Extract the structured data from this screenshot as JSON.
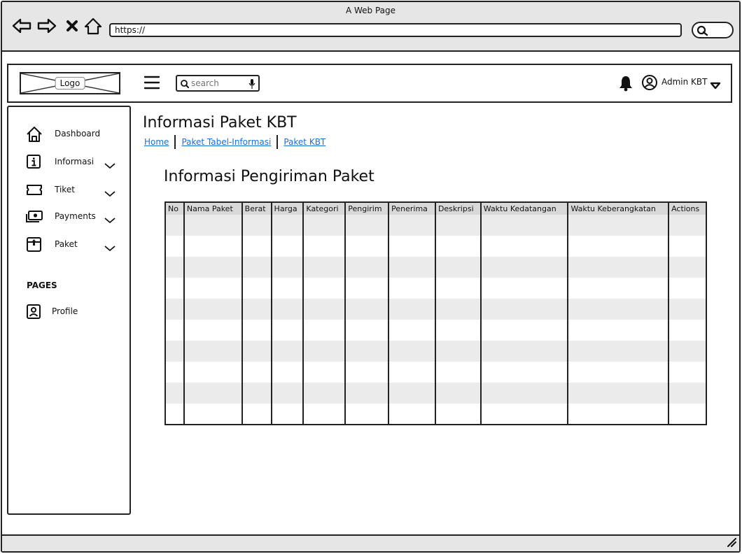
{
  "browser": {
    "title": "A Web Page",
    "url": "https://"
  },
  "topnav": {
    "logo_label": "Logo",
    "search_placeholder": "search",
    "user_name": "Admin KBT"
  },
  "sidebar": {
    "items": [
      {
        "label": "Dashboard",
        "icon": "home-icon",
        "has_dropdown": false
      },
      {
        "label": "Informasi",
        "icon": "info-icon",
        "has_dropdown": true
      },
      {
        "label": "Tiket",
        "icon": "ticket-icon",
        "has_dropdown": true
      },
      {
        "label": "Payments",
        "icon": "payments-icon",
        "has_dropdown": true
      },
      {
        "label": "Paket",
        "icon": "package-icon",
        "has_dropdown": true
      }
    ],
    "pages_heading": "PAGES",
    "pages": [
      {
        "label": "Profile",
        "icon": "profile-icon"
      }
    ]
  },
  "main": {
    "title": "Informasi Paket KBT",
    "breadcrumb": [
      "Home",
      "Paket Tabel-Informasi",
      "Paket KBT"
    ],
    "section_title": "Informasi Pengiriman Paket",
    "table": {
      "columns": [
        "No",
        "Nama Paket",
        "Berat",
        "Harga",
        "Kategori",
        "Pengirim",
        "Penerima",
        "Deskripsi",
        "Waktu Kedatangan",
        "Waktu Keberangkatan",
        "Actions"
      ],
      "rows": [
        [
          "",
          "",
          "",
          "",
          "",
          "",
          "",
          "",
          "",
          "",
          ""
        ],
        [
          "",
          "",
          "",
          "",
          "",
          "",
          "",
          "",
          "",
          "",
          ""
        ],
        [
          "",
          "",
          "",
          "",
          "",
          "",
          "",
          "",
          "",
          "",
          ""
        ],
        [
          "",
          "",
          "",
          "",
          "",
          "",
          "",
          "",
          "",
          "",
          ""
        ],
        [
          "",
          "",
          "",
          "",
          "",
          "",
          "",
          "",
          "",
          "",
          ""
        ],
        [
          "",
          "",
          "",
          "",
          "",
          "",
          "",
          "",
          "",
          "",
          ""
        ],
        [
          "",
          "",
          "",
          "",
          "",
          "",
          "",
          "",
          "",
          "",
          ""
        ],
        [
          "",
          "",
          "",
          "",
          "",
          "",
          "",
          "",
          "",
          "",
          ""
        ],
        [
          "",
          "",
          "",
          "",
          "",
          "",
          "",
          "",
          "",
          "",
          ""
        ],
        [
          "",
          "",
          "",
          "",
          "",
          "",
          "",
          "",
          "",
          "",
          ""
        ]
      ]
    }
  }
}
